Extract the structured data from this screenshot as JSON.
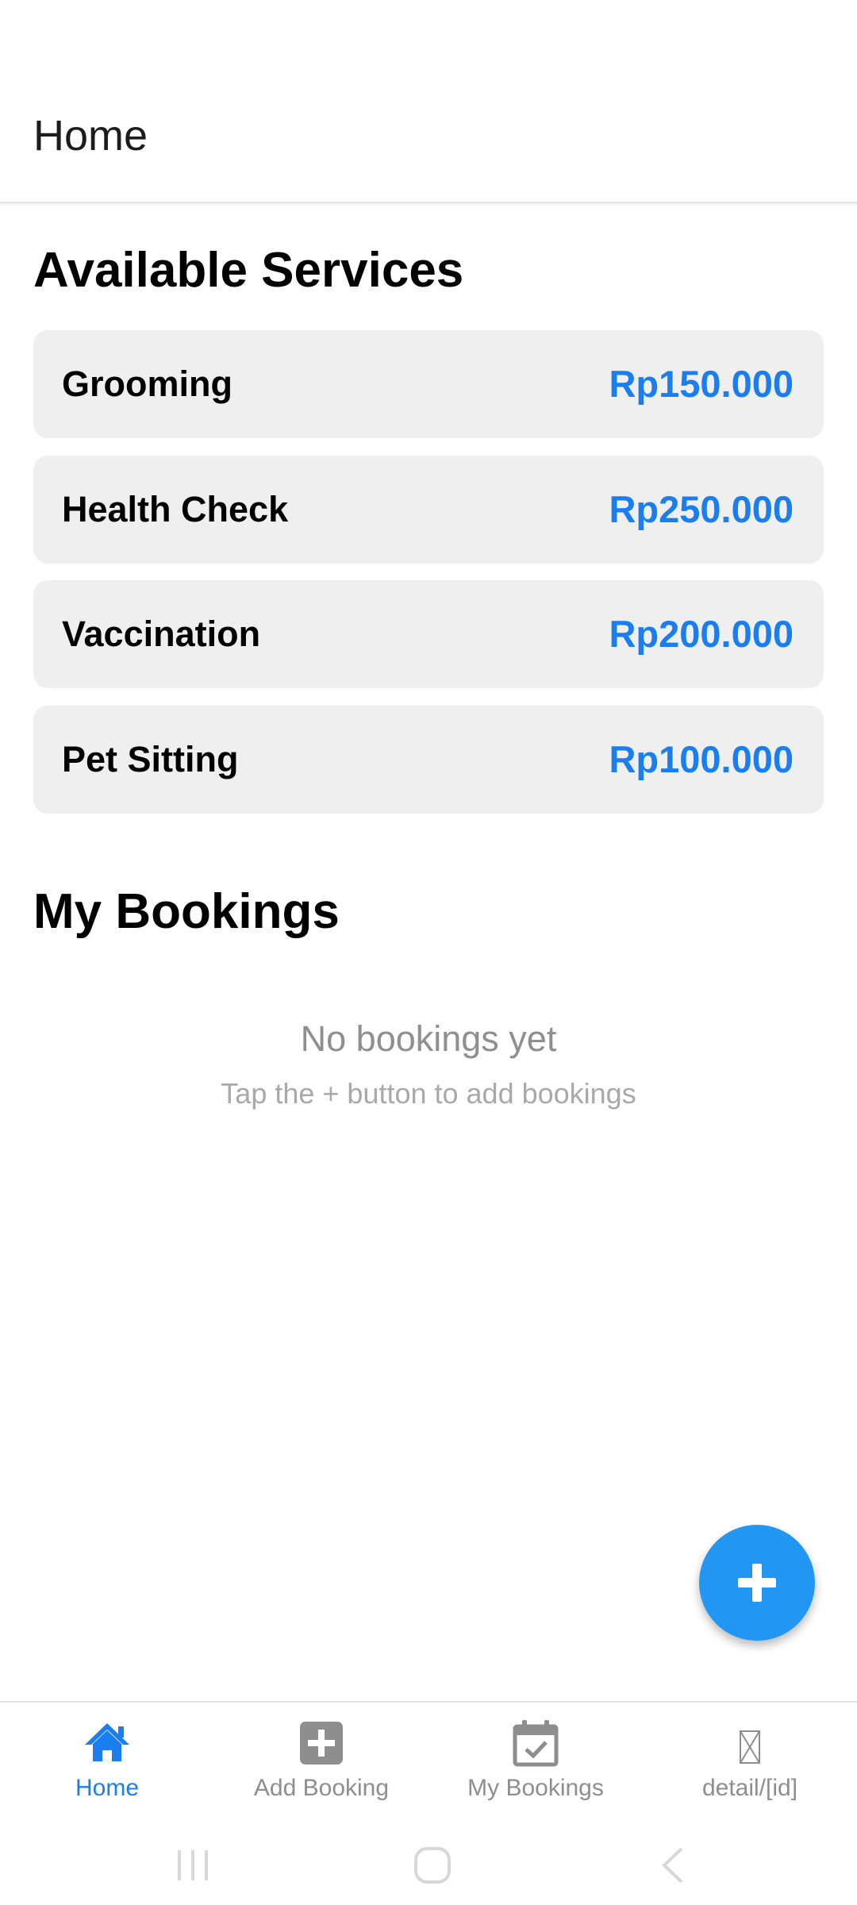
{
  "header": {
    "title": "Home"
  },
  "services": {
    "title": "Available Services",
    "items": [
      {
        "name": "Grooming",
        "price": "Rp150.000"
      },
      {
        "name": "Health Check",
        "price": "Rp250.000"
      },
      {
        "name": "Vaccination",
        "price": "Rp200.000"
      },
      {
        "name": "Pet Sitting",
        "price": "Rp100.000"
      }
    ]
  },
  "bookings": {
    "title": "My Bookings",
    "empty_title": "No bookings yet",
    "empty_subtitle": "Tap the + button to add bookings"
  },
  "fab": {
    "icon": "plus-icon"
  },
  "tabs": [
    {
      "label": "Home",
      "icon": "home-icon",
      "active": true
    },
    {
      "label": "Add Booking",
      "icon": "add-box-icon",
      "active": false
    },
    {
      "label": "My Bookings",
      "icon": "calendar-check-icon",
      "active": false
    },
    {
      "label": "detail/[id]",
      "icon": "missing-icon",
      "active": false
    }
  ],
  "colors": {
    "accent": "#1a7ef0",
    "fab": "#2196f3",
    "card_bg": "#efefef",
    "inactive_tab": "#8e8e8e"
  }
}
